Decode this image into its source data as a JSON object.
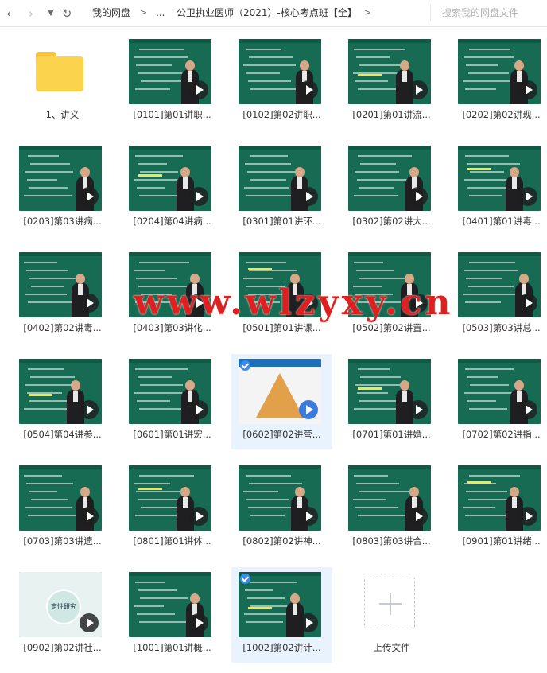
{
  "toolbar": {
    "back_icon": "chevron-left-icon",
    "forward_icon": "chevron-right-icon",
    "history_icon": "caret-down-icon",
    "refresh_icon": "refresh-icon"
  },
  "breadcrumb": {
    "root": "我的网盘",
    "ellipsis": "...",
    "current": "公卫执业医师（2021）-核心考点班【全】",
    "separator": ">"
  },
  "search": {
    "placeholder": "搜索我的网盘文件"
  },
  "watermark": "www.wlzyxy.cn",
  "colors": {
    "board": "#166b52",
    "folder": "#fbd34c",
    "selected_bg": "#e9f3fd",
    "watermark": "#e02020"
  },
  "files": [
    {
      "label": "1、讲义",
      "type": "folder"
    },
    {
      "label": "[0101]第01讲职...",
      "type": "video"
    },
    {
      "label": "[0102]第02讲职...",
      "type": "video"
    },
    {
      "label": "[0201]第01讲流...",
      "type": "video"
    },
    {
      "label": "[0202]第02讲现...",
      "type": "video"
    },
    {
      "label": "[0203]第03讲病...",
      "type": "video"
    },
    {
      "label": "[0204]第04讲病...",
      "type": "video"
    },
    {
      "label": "[0301]第01讲环...",
      "type": "video"
    },
    {
      "label": "[0302]第02讲大...",
      "type": "video"
    },
    {
      "label": "[0401]第01讲毒...",
      "type": "video"
    },
    {
      "label": "[0402]第02讲毒...",
      "type": "video"
    },
    {
      "label": "[0403]第03讲化...",
      "type": "video"
    },
    {
      "label": "[0501]第01讲课...",
      "type": "video"
    },
    {
      "label": "[0502]第02讲置...",
      "type": "video"
    },
    {
      "label": "[0503]第03讲总...",
      "type": "video"
    },
    {
      "label": "[0504]第04讲参...",
      "type": "video"
    },
    {
      "label": "[0601]第01讲宏...",
      "type": "video"
    },
    {
      "label": "[0602]第02讲营...",
      "type": "video",
      "selected": true
    },
    {
      "label": "[0701]第01讲婚...",
      "type": "video"
    },
    {
      "label": "[0702]第02讲指...",
      "type": "video"
    },
    {
      "label": "[0703]第03讲遗...",
      "type": "video"
    },
    {
      "label": "[0801]第01讲体...",
      "type": "video"
    },
    {
      "label": "[0802]第02讲神...",
      "type": "video"
    },
    {
      "label": "[0803]第03讲合...",
      "type": "video"
    },
    {
      "label": "[0901]第01讲绪...",
      "type": "video"
    },
    {
      "label": "[0902]第02讲社...",
      "type": "video"
    },
    {
      "label": "[1001]第01讲概...",
      "type": "video"
    },
    {
      "label": "[1002]第02讲计...",
      "type": "video",
      "selected": true
    },
    {
      "label": "上传文件",
      "type": "upload"
    }
  ],
  "thumb_texts": {
    "0902": "定性研究"
  }
}
